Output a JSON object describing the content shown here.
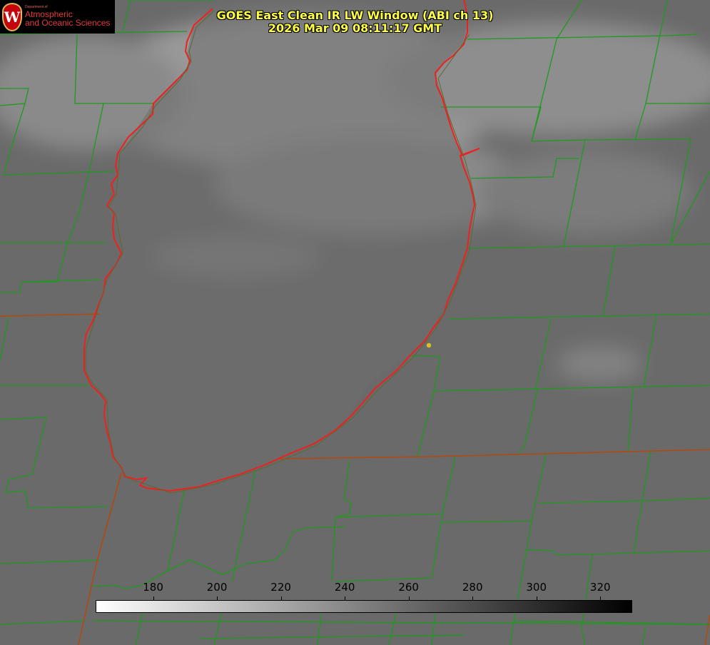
{
  "header": {
    "title_line1": "GOES East Clean IR LW Window (ABI ch 13)",
    "title_line2": "2026 Mar 09 08:11:17 GMT"
  },
  "logo": {
    "crest_letter": "W",
    "dept_label": "Department of",
    "line1": "Atmospheric",
    "line2": "and Oceanic Sciences",
    "icon": "uw-crest-icon"
  },
  "colorbar": {
    "ticks": [
      {
        "value": 180,
        "label": "180"
      },
      {
        "value": 200,
        "label": "200"
      },
      {
        "value": 220,
        "label": "220"
      },
      {
        "value": 240,
        "label": "240"
      },
      {
        "value": 260,
        "label": "260"
      },
      {
        "value": 280,
        "label": "280"
      },
      {
        "value": 300,
        "label": "300"
      },
      {
        "value": 320,
        "label": "320"
      }
    ],
    "range": [
      162,
      330
    ],
    "gradient": "white-to-black"
  },
  "colors": {
    "background": "#6c6c6c",
    "county_lines": "#1e9a1e",
    "state_lines": "#b04a10",
    "lake_shoreline": "#ee2020",
    "title_text": "#ffff44",
    "marker": "#d8c020",
    "logo_red": "#c5050c"
  }
}
